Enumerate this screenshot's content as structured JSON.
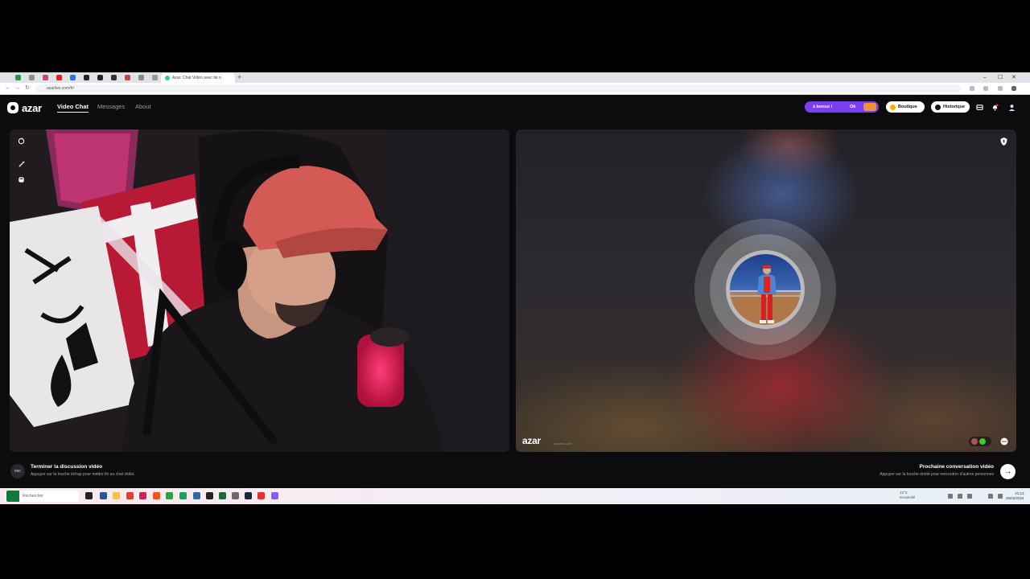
{
  "browser": {
    "tab_title": "Azar: Chat Vidéo avec de n",
    "url": "azarlive.com/fr/",
    "new_tab": "+",
    "window_controls": [
      "–",
      "☐",
      "✕"
    ]
  },
  "site": {
    "logo_text": "azar",
    "nav": {
      "video_chat": "Video Chat",
      "messages": "Messages",
      "about": "About"
    },
    "bonus_label": "≥ bonus !",
    "bonus_value": "Ok",
    "shop_label": "Boutique",
    "history_label": "Historique",
    "accent_color": "#7b3ff2"
  },
  "remote": {
    "watermark": "azar",
    "watermark_sub": "azarlive.com"
  },
  "controls": {
    "esc_key": "esc",
    "end_title": "Terminer la discussion vidéo",
    "end_subtitle": "Appuyer sur la touche échap pour mettre fin au chat vidéo.",
    "next_title": "Prochaine conversation vidéo",
    "next_subtitle": "Appuyer sur la touche droite pour rencontrer d'autres personnes",
    "next_arrow": "→"
  },
  "taskbar": {
    "search_placeholder": "Rechercher",
    "weather_temp": "13°C",
    "weather_desc": "Ensoleillé",
    "time": "21:13",
    "date": "25/03/2024"
  }
}
